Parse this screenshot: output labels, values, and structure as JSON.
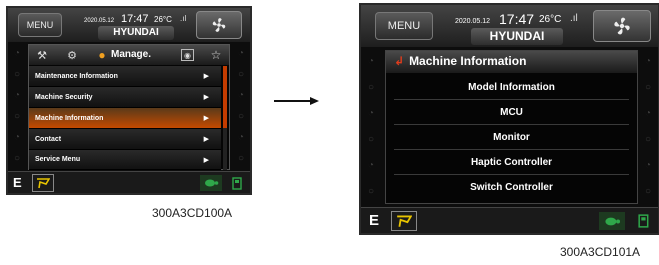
{
  "screen_a": {
    "menu_label": "MENU",
    "date": "2020.05.12",
    "time": "17:47",
    "temperature": "26°C",
    "brand": "HYUNDAI",
    "header_label": "Manage.",
    "menu_items": [
      {
        "label": "Maintenance Information",
        "arrow": "▶"
      },
      {
        "label": "Machine Security",
        "arrow": "▶"
      },
      {
        "label": "Machine Information",
        "arrow": "▶"
      },
      {
        "label": "Contact",
        "arrow": "▶"
      },
      {
        "label": "Service Menu",
        "arrow": "▶"
      }
    ],
    "selected_index": 2,
    "gear_label": "E"
  },
  "screen_b": {
    "menu_label": "MENU",
    "date": "2020.05.12",
    "time": "17:47",
    "temperature": "26°C",
    "brand": "HYUNDAI",
    "title": "Machine Information",
    "items": [
      "Model Information",
      "MCU",
      "Monitor",
      "Haptic Controller",
      "Switch Controller"
    ],
    "gear_label": "E"
  },
  "captions": {
    "left": "300A3CD100A",
    "right": "300A3CD101A"
  },
  "colors": {
    "accent": "#c44a00",
    "back_arrow": "#e23c1c",
    "eco_green": "#2fa84a"
  }
}
